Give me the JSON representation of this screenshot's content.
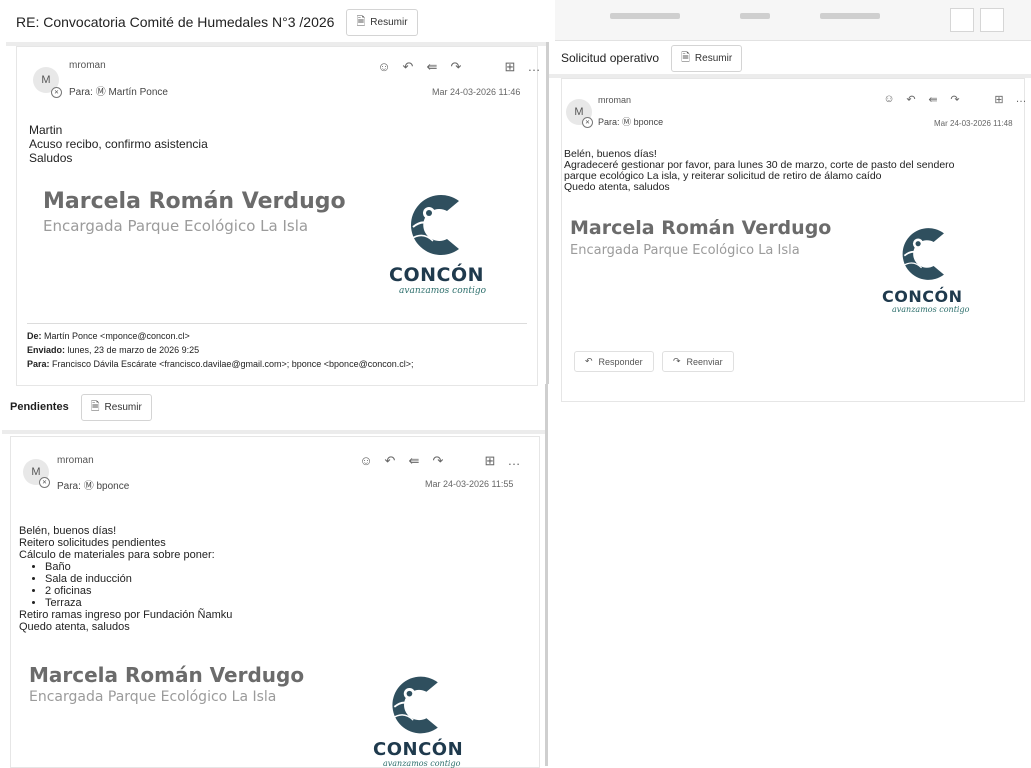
{
  "email_a": {
    "subject": "RE: Convocatoria Comité de Humedales N°3 /2026",
    "summarize_label": "Resumir",
    "avatar": "M",
    "sender": "mroman",
    "to_prefix": "Para:",
    "to": "Martín Ponce",
    "timestamp": "Mar 24-03-2026 11:46",
    "body": [
      "Martin",
      "Acuso recibo, confirmo asistencia",
      "Saludos"
    ],
    "signature": {
      "name": "Marcela Román Verdugo",
      "title": "Encargada Parque Ecológico La Isla"
    },
    "logo": {
      "wordmark": "CONCÓN",
      "tagline": "avanzamos contigo"
    },
    "quoted": {
      "from_label": "De:",
      "from": "Martín Ponce <mponce@concon.cl>",
      "sent_label": "Enviado:",
      "sent": "lunes, 23 de marzo de 2026 9:25",
      "to_label": "Para:",
      "to": "Francisco Dávila Escárate <francisco.davilae@gmail.com>; bponce <bponce@concon.cl>;"
    }
  },
  "email_b": {
    "subject": "Solicitud operativo",
    "summarize_label": "Resumir",
    "avatar": "M",
    "sender": "mroman",
    "to_prefix": "Para:",
    "to": "bponce",
    "timestamp": "Mar 24-03-2026 11:48",
    "body": [
      "Belén, buenos días!",
      "Agradeceré gestionar por favor, para lunes 30 de marzo, corte de pasto del sendero",
      "parque ecológico La isla, y reiterar solicitud de retiro de álamo caído",
      "Quedo atenta, saludos"
    ],
    "signature": {
      "name": "Marcela Román Verdugo",
      "title": "Encargada Parque Ecológico La Isla"
    },
    "logo": {
      "wordmark": "CONCÓN",
      "tagline": "avanzamos contigo"
    },
    "reply_label": "Responder",
    "forward_label": "Reenviar"
  },
  "email_c": {
    "subject": "Pendientes",
    "summarize_label": "Resumir",
    "avatar": "M",
    "sender": "mroman",
    "to_prefix": "Para:",
    "to": "bponce",
    "timestamp": "Mar 24-03-2026 11:55",
    "body_intro": [
      "Belén, buenos días!",
      "Reitero solicitudes pendientes",
      "Cálculo de materiales para sobre poner:"
    ],
    "body_list": [
      "Baño",
      "Sala de inducción",
      "2 oficinas",
      "Terraza"
    ],
    "body_outro": [
      "Retiro ramas ingreso por Fundación Ñamku",
      "Quedo atenta, saludos"
    ],
    "signature": {
      "name": "Marcela Román Verdugo",
      "title": "Encargada Parque Ecológico La Isla"
    },
    "logo": {
      "wordmark": "CONCÓN",
      "tagline": "avanzamos contigo"
    }
  },
  "icons": [
    "emoji-icon",
    "reply-icon",
    "reply-all-icon",
    "forward-icon",
    "apps-icon",
    "more-icon",
    "summarize-icon",
    "at-icon"
  ],
  "colors": {
    "logo_navy": "#1f3a4d",
    "logo_teal": "#2d6f6c",
    "signature_gray": "#6b6b6b"
  }
}
